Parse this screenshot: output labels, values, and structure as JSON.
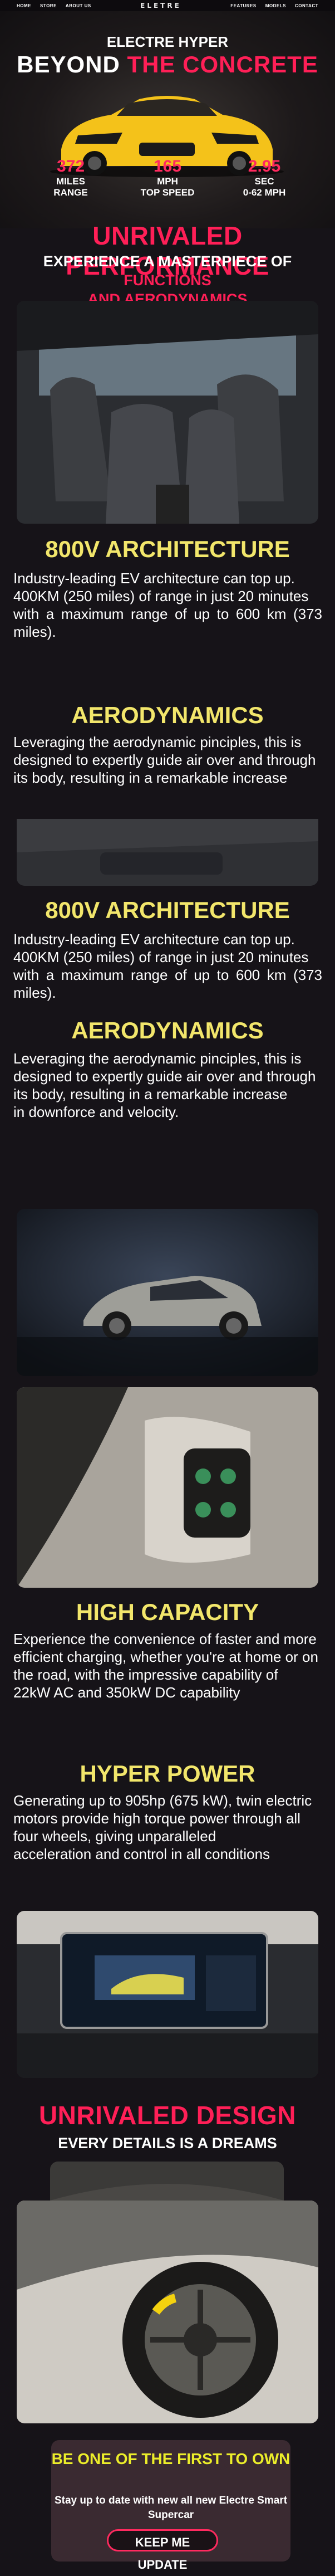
{
  "nav": {
    "left": [
      "HOME",
      "STORE",
      "ABOUT US"
    ],
    "logo": "ELETRE",
    "right": [
      "FEATURES",
      "MODELS",
      "CONTACT"
    ]
  },
  "hero": {
    "subtitle": "ELECTRE HYPER",
    "title_plain": "BEYOND",
    "title_accent": "THE CONCRETE",
    "stats": [
      {
        "value": "372",
        "label1": "MILES",
        "label2": "RANGE"
      },
      {
        "value": "165",
        "label1": "MPH",
        "label2": "TOP SPEED"
      },
      {
        "value": "2.95",
        "label1": "SEC",
        "label2": "0-62 MPH"
      }
    ]
  },
  "performance": {
    "title": "UNRIVALED PERFORMANCE",
    "subtitle_plain": "EXPERIENCE A MASTERPIECE OF",
    "subtitle_accent1": "FUNCTIONS",
    "subtitle_accent2": "AND AERODYNAMICS"
  },
  "sections": [
    {
      "title": "800V ARCHITECTURE",
      "text": "Industry-leading EV architecture can top up.\n400KM (250 miles) of range in just 20 minutes\nwith a maximum range of up to 600 km (373 miles)."
    },
    {
      "title": "AERODYNAMICS",
      "text": "Leveraging the aerodynamic pinciples, this is\ndesigned to expertly guide air over and through\nits body, resulting in a remarkable increase"
    },
    {
      "title": "800V ARCHITECTURE",
      "text": "Industry-leading EV architecture can top up.\n400KM (250 miles) of range in just 20 minutes\nwith a maximum range of up to 600 km (373 miles)."
    },
    {
      "title": "AERODYNAMICS",
      "text": "Leveraging the aerodynamic pinciples, this is\ndesigned to expertly guide air over and through\nits body, resulting in a remarkable increase\nin downforce and velocity."
    },
    {
      "title": "HIGH CAPACITY",
      "text": "Experience the convenience of faster and more\nefficient charging, whether you're at home or on\nthe road, with the impressive capability of\n22kW AC and 350kW DC capability"
    },
    {
      "title": "HYPER POWER",
      "text": "Generating up to 905hp (675 kW), twin electric\nmotors provide high torque power through all\nfour wheels, giving unparalleled\nacceleration and control in all conditions"
    }
  ],
  "design": {
    "title": "UNRIVALED DESIGN",
    "subtitle": "EVERY DETAILS IS A DREAMS"
  },
  "cta": {
    "title": "BE ONE OF THE FIRST TO OWN",
    "text": "Stay up to date with new all new Electre Smart Supercar",
    "button": "KEEP ME UPDATE"
  },
  "colors": {
    "accent_red": "#ff1f57",
    "heading_yellow": "#f2e66b",
    "cta_yellow": "#ecee2a",
    "car_yellow": "#f4c21a",
    "background": "#161318"
  }
}
